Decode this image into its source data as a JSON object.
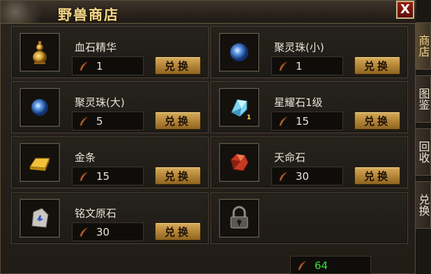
{
  "window": {
    "title": "野兽商店",
    "close_label": "X"
  },
  "tabs": [
    {
      "label": "商店",
      "active": true
    },
    {
      "label": "图鉴",
      "active": false
    },
    {
      "label": "回收",
      "active": false
    },
    {
      "label": "兑换",
      "active": false
    }
  ],
  "items": [
    {
      "name": "血石精华",
      "price": "1",
      "button": "兑换",
      "icon": "gourd-icon"
    },
    {
      "name": "聚灵珠(小)",
      "price": "1",
      "button": "兑换",
      "icon": "blue-orb-icon"
    },
    {
      "name": "聚灵珠(大)",
      "price": "5",
      "button": "兑换",
      "icon": "blue-orb-icon"
    },
    {
      "name": "星耀石1级",
      "price": "15",
      "button": "兑换",
      "icon": "crystal-icon",
      "badge": "1"
    },
    {
      "name": "金条",
      "price": "15",
      "button": "兑换",
      "icon": "gold-bar-icon"
    },
    {
      "name": "天命石",
      "price": "30",
      "button": "兑换",
      "icon": "red-gem-icon"
    },
    {
      "name": "铭文原石",
      "price": "30",
      "button": "兑换",
      "icon": "rune-stone-icon"
    }
  ],
  "locked_slot": {
    "icon": "lock-icon"
  },
  "currency": {
    "amount": "64",
    "icon": "feather-icon"
  },
  "colors": {
    "accent": "#f3d68a",
    "currency": "#36e03c",
    "button": "#c8973f"
  }
}
